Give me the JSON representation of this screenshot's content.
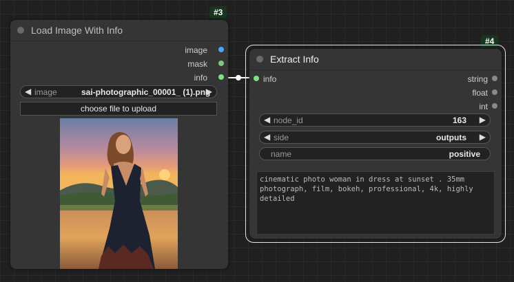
{
  "node3": {
    "id_badge": "#3",
    "title": "Load Image With Info",
    "outputs": [
      {
        "label": "image",
        "color": "#4da3ff"
      },
      {
        "label": "mask",
        "color": "#81c784"
      },
      {
        "label": "info",
        "color": "#7fe07f"
      }
    ],
    "image_widget": {
      "label": "image",
      "value": "sai-photographic_00001_ (1).png"
    },
    "upload_label": "choose file to upload"
  },
  "node4": {
    "id_badge": "#4",
    "title": "Extract Info",
    "input": {
      "label": "info",
      "color": "#7fe07f"
    },
    "outputs": [
      {
        "label": "string",
        "color": "#888888"
      },
      {
        "label": "float",
        "color": "#888888"
      },
      {
        "label": "int",
        "color": "#888888"
      }
    ],
    "widgets": [
      {
        "label": "node_id",
        "value": "163"
      },
      {
        "label": "side",
        "value": "outputs"
      },
      {
        "label": "name",
        "value": "positive"
      }
    ],
    "text_output": "cinematic photo woman in dress at sunset . 35mm photograph, film, bokeh, professional, 4k, highly detailed"
  },
  "icons": {
    "left_arrow": "◀",
    "right_arrow": "▶"
  }
}
